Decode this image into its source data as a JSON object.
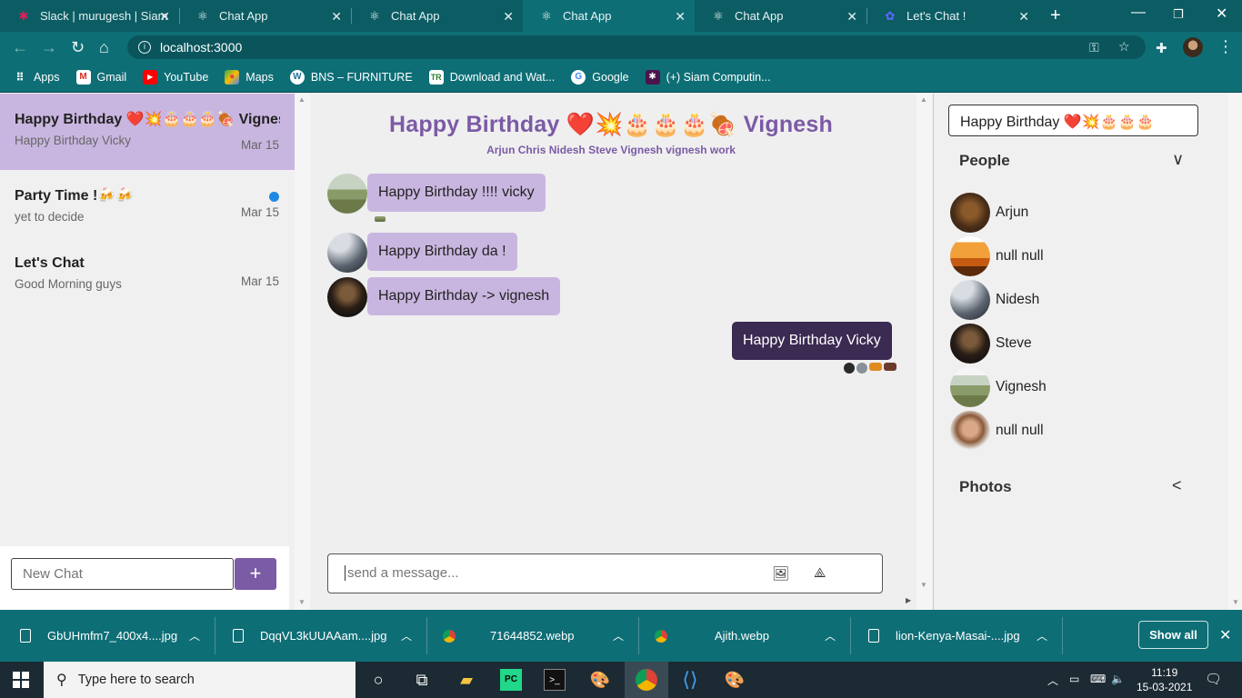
{
  "browser": {
    "tabs": [
      {
        "title": "Slack | murugesh | Siam",
        "icon": "slack-icon"
      },
      {
        "title": "Chat App",
        "icon": "react-icon"
      },
      {
        "title": "Chat App",
        "icon": "react-icon"
      },
      {
        "title": "Chat App",
        "icon": "react-icon",
        "active": true
      },
      {
        "title": "Chat App",
        "icon": "react-icon"
      },
      {
        "title": "Let's Chat !",
        "icon": "chat-icon"
      }
    ],
    "url": "localhost:3000",
    "bookmarks": [
      {
        "label": "Apps",
        "icon": "apps-grid-icon"
      },
      {
        "label": "Gmail",
        "icon": "gmail-icon"
      },
      {
        "label": "YouTube",
        "icon": "youtube-icon"
      },
      {
        "label": "Maps",
        "icon": "maps-icon"
      },
      {
        "label": "BNS – FURNITURE",
        "icon": "wordpress-icon"
      },
      {
        "label": "Download and Wat...",
        "icon": "tr-icon"
      },
      {
        "label": "Google",
        "icon": "google-icon"
      },
      {
        "label": "(+) Siam Computin...",
        "icon": "slack-icon"
      }
    ]
  },
  "sidebar": {
    "chats": [
      {
        "title": "Happy Birthday ❤️💥🎂🎂🎂🍖 Vignesh",
        "subtitle": "Happy Birthday Vicky",
        "date": "Mar 15",
        "selected": true
      },
      {
        "title": "Party Time !🍻🍻",
        "subtitle": "yet to decide",
        "date": "Mar 15",
        "unread": true
      },
      {
        "title": "Let's Chat",
        "subtitle": "Good Morning guys",
        "date": "Mar 15"
      }
    ],
    "new_chat_placeholder": "New Chat",
    "new_chat_button": "+"
  },
  "chat": {
    "title": "Happy Birthday ❤️💥🎂🎂🎂🍖 Vignesh",
    "members": "Arjun Chris Nidesh Steve Vignesh vignesh work",
    "messages": [
      {
        "text": "Happy Birthday !!!! vicky",
        "own": false
      },
      {
        "text": "Happy Birthday da !",
        "own": false
      },
      {
        "text": "Happy Birthday -> vignesh",
        "own": false
      },
      {
        "text": "Happy Birthday Vicky",
        "own": true
      }
    ],
    "composer_placeholder": "send a message..."
  },
  "details": {
    "title_value": "Happy Birthday ❤️💥🎂🎂🎂",
    "people_label": "People",
    "people": [
      {
        "name": "Arjun",
        "online": true
      },
      {
        "name": "null null",
        "online": false
      },
      {
        "name": "Nidesh",
        "online": false
      },
      {
        "name": "Steve",
        "online": false
      },
      {
        "name": "Vignesh",
        "online": false
      },
      {
        "name": "null null",
        "online": false
      }
    ],
    "photos_label": "Photos"
  },
  "downloads": [
    {
      "name": "GbUHmfm7_400x4....jpg",
      "type": "file"
    },
    {
      "name": "DqqVL3kUUAAam....jpg",
      "type": "file"
    },
    {
      "name": "71644852.webp",
      "type": "chrome"
    },
    {
      "name": "Ajith.webp",
      "type": "chrome"
    },
    {
      "name": "lion-Kenya-Masai-....jpg",
      "type": "file"
    }
  ],
  "show_all": "Show all",
  "taskbar": {
    "search_placeholder": "Type here to search",
    "time": "11:19",
    "date": "15-03-2021"
  },
  "colors": {
    "accent": "#7b5aa6",
    "bubble": "#c9b6e0",
    "own_bubble": "#3b2a52",
    "chrome": "#0e6e76"
  }
}
